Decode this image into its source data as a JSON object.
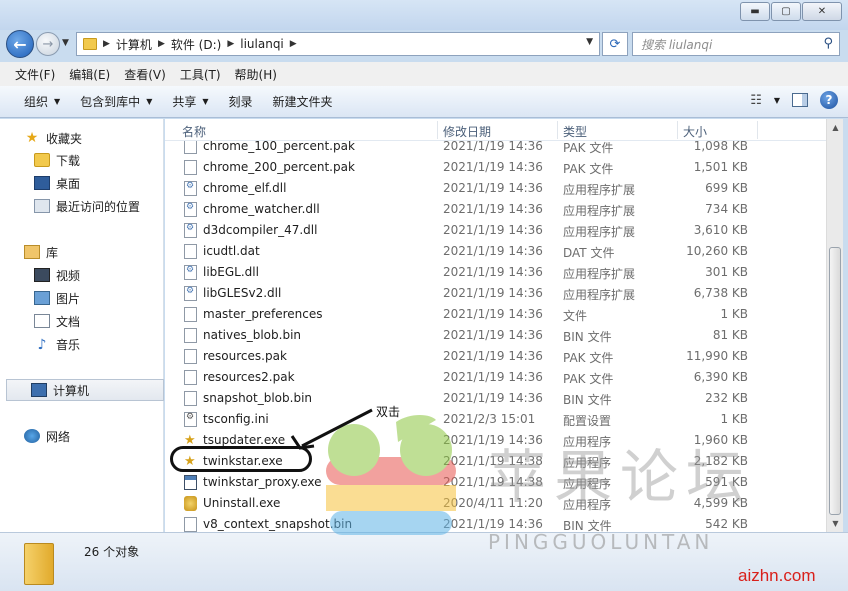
{
  "window": {
    "minimize": "▬",
    "maximize": "▢",
    "close": "✕"
  },
  "address": {
    "crumbs": [
      "计算机",
      "软件 (D:)",
      "liulanqi"
    ],
    "search_placeholder": "搜索 liulanqi"
  },
  "menu": [
    "文件(F)",
    "编辑(E)",
    "查看(V)",
    "工具(T)",
    "帮助(H)"
  ],
  "toolbar": {
    "organize": "组织",
    "include": "包含到库中",
    "share": "共享",
    "burn": "刻录",
    "new_folder": "新建文件夹"
  },
  "nav": {
    "favorites": "收藏夹",
    "downloads": "下载",
    "desktop": "桌面",
    "recent": "最近访问的位置",
    "libraries": "库",
    "videos": "视频",
    "pictures": "图片",
    "documents": "文档",
    "music": "音乐",
    "computer": "计算机",
    "network": "网络"
  },
  "columns": {
    "name": "名称",
    "date": "修改日期",
    "type": "类型",
    "size": "大小"
  },
  "files": [
    {
      "name": "chrome_100_percent.pak",
      "date": "2021/1/19 14:36",
      "type": "PAK 文件",
      "size": "1,098 KB",
      "icon": "file"
    },
    {
      "name": "chrome_200_percent.pak",
      "date": "2021/1/19 14:36",
      "type": "PAK 文件",
      "size": "1,501 KB",
      "icon": "file"
    },
    {
      "name": "chrome_elf.dll",
      "date": "2021/1/19 14:36",
      "type": "应用程序扩展",
      "size": "699 KB",
      "icon": "dll"
    },
    {
      "name": "chrome_watcher.dll",
      "date": "2021/1/19 14:36",
      "type": "应用程序扩展",
      "size": "734 KB",
      "icon": "dll"
    },
    {
      "name": "d3dcompiler_47.dll",
      "date": "2021/1/19 14:36",
      "type": "应用程序扩展",
      "size": "3,610 KB",
      "icon": "dll"
    },
    {
      "name": "icudtl.dat",
      "date": "2021/1/19 14:36",
      "type": "DAT 文件",
      "size": "10,260 KB",
      "icon": "file"
    },
    {
      "name": "libEGL.dll",
      "date": "2021/1/19 14:36",
      "type": "应用程序扩展",
      "size": "301 KB",
      "icon": "dll"
    },
    {
      "name": "libGLESv2.dll",
      "date": "2021/1/19 14:36",
      "type": "应用程序扩展",
      "size": "6,738 KB",
      "icon": "dll"
    },
    {
      "name": "master_preferences",
      "date": "2021/1/19 14:36",
      "type": "文件",
      "size": "1 KB",
      "icon": "file"
    },
    {
      "name": "natives_blob.bin",
      "date": "2021/1/19 14:36",
      "type": "BIN 文件",
      "size": "81 KB",
      "icon": "file"
    },
    {
      "name": "resources.pak",
      "date": "2021/1/19 14:36",
      "type": "PAK 文件",
      "size": "11,990 KB",
      "icon": "file"
    },
    {
      "name": "resources2.pak",
      "date": "2021/1/19 14:36",
      "type": "PAK 文件",
      "size": "6,390 KB",
      "icon": "file"
    },
    {
      "name": "snapshot_blob.bin",
      "date": "2021/1/19 14:36",
      "type": "BIN 文件",
      "size": "232 KB",
      "icon": "file"
    },
    {
      "name": "tsconfig.ini",
      "date": "2021/2/3 15:01",
      "type": "配置设置",
      "size": "1 KB",
      "icon": "ini"
    },
    {
      "name": "tsupdater.exe",
      "date": "2021/1/19 14:36",
      "type": "应用程序",
      "size": "1,960 KB",
      "icon": "exe-star"
    },
    {
      "name": "twinkstar.exe",
      "date": "2021/1/19 14:38",
      "type": "应用程序",
      "size": "2,182 KB",
      "icon": "exe-star"
    },
    {
      "name": "twinkstar_proxy.exe",
      "date": "2021/1/19 14:38",
      "type": "应用程序",
      "size": "591 KB",
      "icon": "exe-app"
    },
    {
      "name": "Uninstall.exe",
      "date": "2020/4/11 11:20",
      "type": "应用程序",
      "size": "4,599 KB",
      "icon": "exe-gold"
    },
    {
      "name": "v8_context_snapshot.bin",
      "date": "2021/1/19 14:36",
      "type": "BIN 文件",
      "size": "542 KB",
      "icon": "file"
    }
  ],
  "status": {
    "count": "26 个对象"
  },
  "annotation": {
    "label": "双击"
  },
  "watermark": {
    "cn": "苹果论坛",
    "en": "PINGGUOLUNTAN",
    "site": "aizhn.com"
  }
}
